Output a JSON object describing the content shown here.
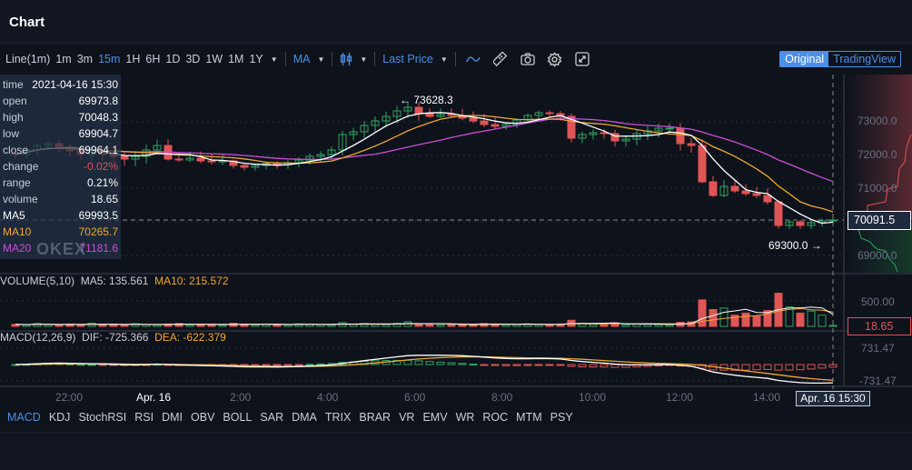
{
  "header": {
    "title": "Chart"
  },
  "toolbar": {
    "intervals": [
      "Line(1m)",
      "1m",
      "3m",
      "15m",
      "1H",
      "6H",
      "1D",
      "3D",
      "1W",
      "1M",
      "1Y"
    ],
    "active_interval": "15m",
    "indicator": "MA",
    "price_type": "Last Price",
    "icons": [
      "candlestick-icon",
      "line-draw-icon",
      "ruler-icon",
      "camera-icon",
      "gear-icon",
      "fullscreen-icon"
    ],
    "view_toggle": {
      "original": "Original",
      "tradingview": "TradingView",
      "active": "Original"
    }
  },
  "tooltip": {
    "rows": [
      {
        "label": "time",
        "value": "2021-04-16 15:30"
      },
      {
        "label": "open",
        "value": "69973.8"
      },
      {
        "label": "high",
        "value": "70048.3"
      },
      {
        "label": "low",
        "value": "69904.7"
      },
      {
        "label": "close",
        "value": "69964.1"
      },
      {
        "label": "change",
        "value": "-0.02%"
      },
      {
        "label": "range",
        "value": "0.21%"
      },
      {
        "label": "volume",
        "value": "18.65"
      },
      {
        "label": "MA5",
        "value": "69993.5"
      },
      {
        "label": "MA10",
        "value": "70265.7"
      },
      {
        "label": "MA20",
        "value": "71181.6"
      }
    ]
  },
  "watermark": "OKEX",
  "annotations": {
    "high": "73628.3",
    "low": "69300.0"
  },
  "price_axis": [
    "73000.0",
    "72000.0",
    "71000.0",
    "69000.0"
  ],
  "current_price": "70091.5",
  "volume_panel": {
    "title": "VOLUME(5,10)",
    "ma5": "MA5: 135.561",
    "ma10": "MA10: 215.572",
    "axis": "500.00",
    "current": "18.65"
  },
  "macd_panel": {
    "title": "MACD(12,26,9)",
    "dif": "DIF: -725.366",
    "dea": "DEA: -622.379",
    "axis_top": "731.47",
    "axis_bottom": "-731.47"
  },
  "time_axis": [
    "22:00",
    "Apr. 16",
    "2:00",
    "4:00",
    "6:00",
    "8:00",
    "10:00",
    "12:00",
    "14:00"
  ],
  "crosshair_time": "Apr. 16 15:30",
  "indicator_tabs": [
    "MACD",
    "KDJ",
    "StochRSI",
    "RSI",
    "DMI",
    "OBV",
    "BOLL",
    "SAR",
    "DMA",
    "TRIX",
    "BRAR",
    "VR",
    "EMV",
    "WR",
    "ROC",
    "MTM",
    "PSY"
  ],
  "active_indicator_tab": "MACD",
  "colors": {
    "up": "#2ea661",
    "down": "#e05555",
    "ma5": "#ffffff",
    "ma10": "#f0a830",
    "ma20": "#cc4fd6",
    "accent": "#4d8fe6",
    "bg": "#0e121b"
  },
  "chart_data": {
    "type": "candlestick",
    "interval": "15m",
    "start_time": "2021-04-15 20:45",
    "end_time": "2021-04-16 15:30",
    "ylim": [
      68700,
      73900
    ],
    "closes": [
      72027,
      72162,
      72297,
      72351,
      72243,
      72135,
      72027,
      72081,
      72027,
      71973,
      71892,
      71973,
      72162,
      72297,
      71892,
      71865,
      71919,
      71838,
      71811,
      71838,
      71703,
      71649,
      71703,
      71757,
      71730,
      71784,
      71865,
      71973,
      72027,
      72162,
      72622,
      72703,
      72892,
      73027,
      73162,
      73324,
      73432,
      73243,
      73162,
      73216,
      73189,
      73108,
      73027,
      72919,
      72865,
      72919,
      73054,
      73189,
      73270,
      73243,
      73162,
      72513,
      72622,
      72676,
      72649,
      72432,
      72486,
      72649,
      72730,
      72811,
      72811,
      72351,
      72297,
      71216,
      70811,
      71081,
      70946,
      70865,
      70811,
      70622,
      69919,
      70027,
      69919,
      70000,
      70054,
      70081
    ],
    "volumes": [
      40,
      30,
      55,
      35,
      25,
      45,
      30,
      60,
      35,
      40,
      25,
      50,
      35,
      30,
      45,
      55,
      30,
      40,
      35,
      25,
      60,
      45,
      30,
      40,
      35,
      30,
      50,
      40,
      35,
      30,
      75,
      45,
      55,
      40,
      35,
      60,
      90,
      45,
      40,
      30,
      35,
      40,
      30,
      55,
      45,
      35,
      40,
      50,
      35,
      30,
      45,
      120,
      60,
      40,
      45,
      70,
      35,
      45,
      40,
      35,
      30,
      80,
      90,
      520,
      330,
      360,
      220,
      260,
      200,
      310,
      650,
      380,
      260,
      300,
      220,
      19
    ]
  }
}
